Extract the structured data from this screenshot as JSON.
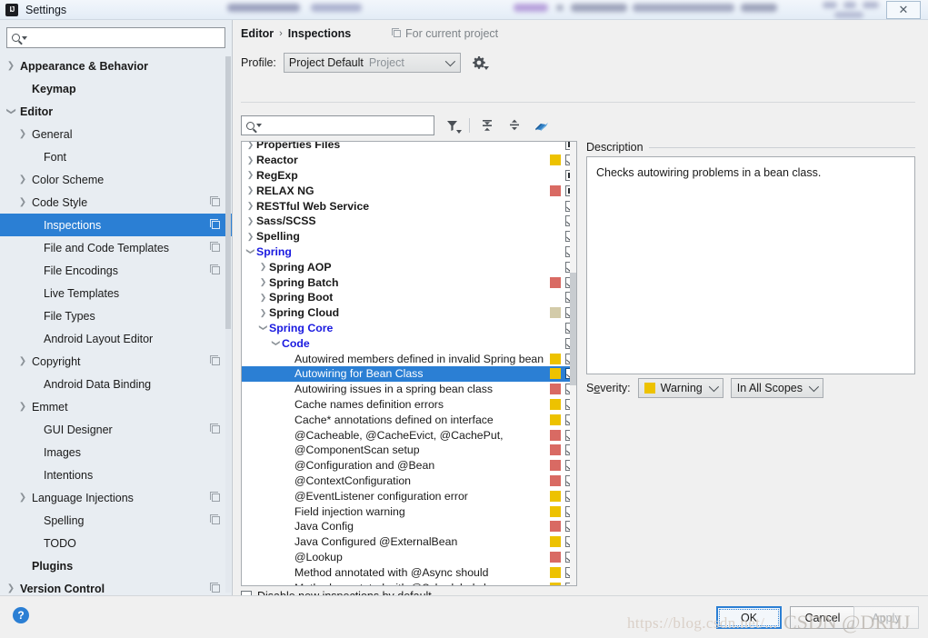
{
  "window": {
    "title": "Settings",
    "app_icon": "intellij-idea-icon",
    "close_label": "✕"
  },
  "sidebar": {
    "search": {
      "value": "",
      "placeholder": ""
    },
    "items": [
      {
        "label": "Appearance & Behavior",
        "arrow": "collapsed",
        "bold": true,
        "indent": 0,
        "copy": false,
        "selected": false
      },
      {
        "label": "Keymap",
        "arrow": "none",
        "bold": true,
        "indent": 1,
        "copy": false,
        "selected": false
      },
      {
        "label": "Editor",
        "arrow": "expanded",
        "bold": true,
        "indent": 0,
        "copy": false,
        "selected": false
      },
      {
        "label": "General",
        "arrow": "collapsed",
        "bold": false,
        "indent": 1,
        "copy": false,
        "selected": false
      },
      {
        "label": "Font",
        "arrow": "none",
        "bold": false,
        "indent": 2,
        "copy": false,
        "selected": false
      },
      {
        "label": "Color Scheme",
        "arrow": "collapsed",
        "bold": false,
        "indent": 1,
        "copy": false,
        "selected": false
      },
      {
        "label": "Code Style",
        "arrow": "collapsed",
        "bold": false,
        "indent": 1,
        "copy": true,
        "selected": false
      },
      {
        "label": "Inspections",
        "arrow": "none",
        "bold": false,
        "indent": 2,
        "copy": true,
        "selected": true
      },
      {
        "label": "File and Code Templates",
        "arrow": "none",
        "bold": false,
        "indent": 2,
        "copy": true,
        "selected": false
      },
      {
        "label": "File Encodings",
        "arrow": "none",
        "bold": false,
        "indent": 2,
        "copy": true,
        "selected": false
      },
      {
        "label": "Live Templates",
        "arrow": "none",
        "bold": false,
        "indent": 2,
        "copy": false,
        "selected": false
      },
      {
        "label": "File Types",
        "arrow": "none",
        "bold": false,
        "indent": 2,
        "copy": false,
        "selected": false
      },
      {
        "label": "Android Layout Editor",
        "arrow": "none",
        "bold": false,
        "indent": 2,
        "copy": false,
        "selected": false
      },
      {
        "label": "Copyright",
        "arrow": "collapsed",
        "bold": false,
        "indent": 1,
        "copy": true,
        "selected": false
      },
      {
        "label": "Android Data Binding",
        "arrow": "none",
        "bold": false,
        "indent": 2,
        "copy": false,
        "selected": false
      },
      {
        "label": "Emmet",
        "arrow": "collapsed",
        "bold": false,
        "indent": 1,
        "copy": false,
        "selected": false
      },
      {
        "label": "GUI Designer",
        "arrow": "none",
        "bold": false,
        "indent": 2,
        "copy": true,
        "selected": false
      },
      {
        "label": "Images",
        "arrow": "none",
        "bold": false,
        "indent": 2,
        "copy": false,
        "selected": false
      },
      {
        "label": "Intentions",
        "arrow": "none",
        "bold": false,
        "indent": 2,
        "copy": false,
        "selected": false
      },
      {
        "label": "Language Injections",
        "arrow": "collapsed",
        "bold": false,
        "indent": 1,
        "copy": true,
        "selected": false
      },
      {
        "label": "Spelling",
        "arrow": "none",
        "bold": false,
        "indent": 2,
        "copy": true,
        "selected": false
      },
      {
        "label": "TODO",
        "arrow": "none",
        "bold": false,
        "indent": 2,
        "copy": false,
        "selected": false
      },
      {
        "label": "Plugins",
        "arrow": "none",
        "bold": true,
        "indent": 1,
        "copy": false,
        "selected": false
      },
      {
        "label": "Version Control",
        "arrow": "collapsed",
        "bold": true,
        "indent": 0,
        "copy": true,
        "selected": false
      }
    ]
  },
  "content": {
    "breadcrumb": {
      "parent": "Editor",
      "separator": "›",
      "current": "Inspections"
    },
    "scope_note": "For current project",
    "profile": {
      "label": "Profile:",
      "selected": "Project Default",
      "qualifier": "Project",
      "gear_icon": "gear-icon"
    },
    "toolbar": {
      "search": {
        "value": "",
        "placeholder": ""
      },
      "buttons": [
        {
          "name": "filter-icon",
          "tooltip": "Filter Inspections"
        },
        {
          "name": "expand-all-icon",
          "tooltip": "Expand All"
        },
        {
          "name": "collapse-all-icon",
          "tooltip": "Collapse All"
        },
        {
          "name": "reset-icon",
          "tooltip": "Reset to Defaults"
        }
      ]
    },
    "tree": [
      {
        "label": "Properties Files",
        "indent": 0,
        "arrow": "collapsed",
        "style": "bold",
        "severity": "",
        "check": "partial",
        "selected": false,
        "clipped": true
      },
      {
        "label": "Reactor",
        "indent": 0,
        "arrow": "collapsed",
        "style": "bold",
        "severity": "yellow",
        "check": "checked",
        "selected": false
      },
      {
        "label": "RegExp",
        "indent": 0,
        "arrow": "collapsed",
        "style": "bold",
        "severity": "",
        "check": "partial",
        "selected": false
      },
      {
        "label": "RELAX NG",
        "indent": 0,
        "arrow": "collapsed",
        "style": "bold",
        "severity": "red",
        "check": "partial",
        "selected": false
      },
      {
        "label": "RESTful Web Service",
        "indent": 0,
        "arrow": "collapsed",
        "style": "bold",
        "severity": "",
        "check": "checked",
        "selected": false
      },
      {
        "label": "Sass/SCSS",
        "indent": 0,
        "arrow": "collapsed",
        "style": "bold",
        "severity": "",
        "check": "checked",
        "selected": false
      },
      {
        "label": "Spelling",
        "indent": 0,
        "arrow": "collapsed",
        "style": "bold",
        "severity": "",
        "check": "checked",
        "selected": false
      },
      {
        "label": "Spring",
        "indent": 0,
        "arrow": "expanded",
        "style": "blue",
        "severity": "",
        "check": "checked",
        "selected": false
      },
      {
        "label": "Spring AOP",
        "indent": 1,
        "arrow": "collapsed",
        "style": "bold",
        "severity": "",
        "check": "checked",
        "selected": false
      },
      {
        "label": "Spring Batch",
        "indent": 1,
        "arrow": "collapsed",
        "style": "bold",
        "severity": "red",
        "check": "checked",
        "selected": false
      },
      {
        "label": "Spring Boot",
        "indent": 1,
        "arrow": "collapsed",
        "style": "bold",
        "severity": "",
        "check": "checked",
        "selected": false
      },
      {
        "label": "Spring Cloud",
        "indent": 1,
        "arrow": "collapsed",
        "style": "bold",
        "severity": "tan",
        "check": "checked",
        "selected": false
      },
      {
        "label": "Spring Core",
        "indent": 1,
        "arrow": "expanded",
        "style": "blue",
        "severity": "",
        "check": "checked",
        "selected": false
      },
      {
        "label": "Code",
        "indent": 2,
        "arrow": "expanded",
        "style": "blue",
        "severity": "",
        "check": "checked",
        "selected": false
      },
      {
        "label": "Autowired members defined in invalid Spring bean class",
        "indent": 3,
        "arrow": "none",
        "style": "normal",
        "severity": "yellow",
        "check": "checked",
        "selected": false
      },
      {
        "label": "Autowiring for Bean Class",
        "indent": 3,
        "arrow": "none",
        "style": "normal",
        "severity": "yellow",
        "check": "checked",
        "selected": true
      },
      {
        "label": "Autowiring issues in a spring bean class",
        "indent": 3,
        "arrow": "none",
        "style": "normal",
        "severity": "red",
        "check": "checked",
        "selected": false
      },
      {
        "label": "Cache names definition errors",
        "indent": 3,
        "arrow": "none",
        "style": "normal",
        "severity": "yellow",
        "check": "checked",
        "selected": false
      },
      {
        "label": "Cache* annotations defined on interface",
        "indent": 3,
        "arrow": "none",
        "style": "normal",
        "severity": "yellow",
        "check": "checked",
        "selected": false
      },
      {
        "label": "@Cacheable, @CacheEvict, @CachePut,",
        "indent": 3,
        "arrow": "none",
        "style": "normal",
        "severity": "red",
        "check": "checked",
        "selected": false
      },
      {
        "label": "@ComponentScan setup",
        "indent": 3,
        "arrow": "none",
        "style": "normal",
        "severity": "red",
        "check": "checked",
        "selected": false
      },
      {
        "label": "@Configuration and @Bean",
        "indent": 3,
        "arrow": "none",
        "style": "normal",
        "severity": "red",
        "check": "checked",
        "selected": false
      },
      {
        "label": "@ContextConfiguration",
        "indent": 3,
        "arrow": "none",
        "style": "normal",
        "severity": "red",
        "check": "checked",
        "selected": false
      },
      {
        "label": "@EventListener configuration error",
        "indent": 3,
        "arrow": "none",
        "style": "normal",
        "severity": "yellow",
        "check": "checked",
        "selected": false
      },
      {
        "label": "Field injection warning",
        "indent": 3,
        "arrow": "none",
        "style": "normal",
        "severity": "yellow",
        "check": "checked",
        "selected": false
      },
      {
        "label": "Java Config",
        "indent": 3,
        "arrow": "none",
        "style": "normal",
        "severity": "red",
        "check": "checked",
        "selected": false
      },
      {
        "label": "Java Configured @ExternalBean",
        "indent": 3,
        "arrow": "none",
        "style": "normal",
        "severity": "yellow",
        "check": "checked",
        "selected": false
      },
      {
        "label": "@Lookup",
        "indent": 3,
        "arrow": "none",
        "style": "normal",
        "severity": "red",
        "check": "checked",
        "selected": false
      },
      {
        "label": "Method annotated with @Async should",
        "indent": 3,
        "arrow": "none",
        "style": "normal",
        "severity": "yellow",
        "check": "checked",
        "selected": false
      },
      {
        "label": "Method annotated with @Scheduled sh",
        "indent": 3,
        "arrow": "none",
        "style": "normal",
        "severity": "yellow",
        "check": "checked",
        "selected": false,
        "clipped": true
      }
    ],
    "disable_new": {
      "label": "Disable new inspections by default",
      "checked": false
    },
    "description": {
      "legend": "Description",
      "text": "Checks autowiring problems in a bean class."
    },
    "severity": {
      "label": "Severity:",
      "value": "Warning",
      "swatch": "yellow",
      "scope": "In All Scopes"
    }
  },
  "buttons": {
    "help": "?",
    "ok": "OK",
    "cancel": "Cancel",
    "apply": "Apply"
  },
  "watermark": {
    "url": "https://blog.csdn.net/...",
    "author": "CSDN @DRHJ"
  },
  "colors": {
    "accent": "#2b7fd4",
    "severity_yellow": "#EDC200",
    "severity_red": "#D96A63",
    "severity_tan": "#D3CBA9",
    "tree_blue_text": "#1a1ae0"
  }
}
